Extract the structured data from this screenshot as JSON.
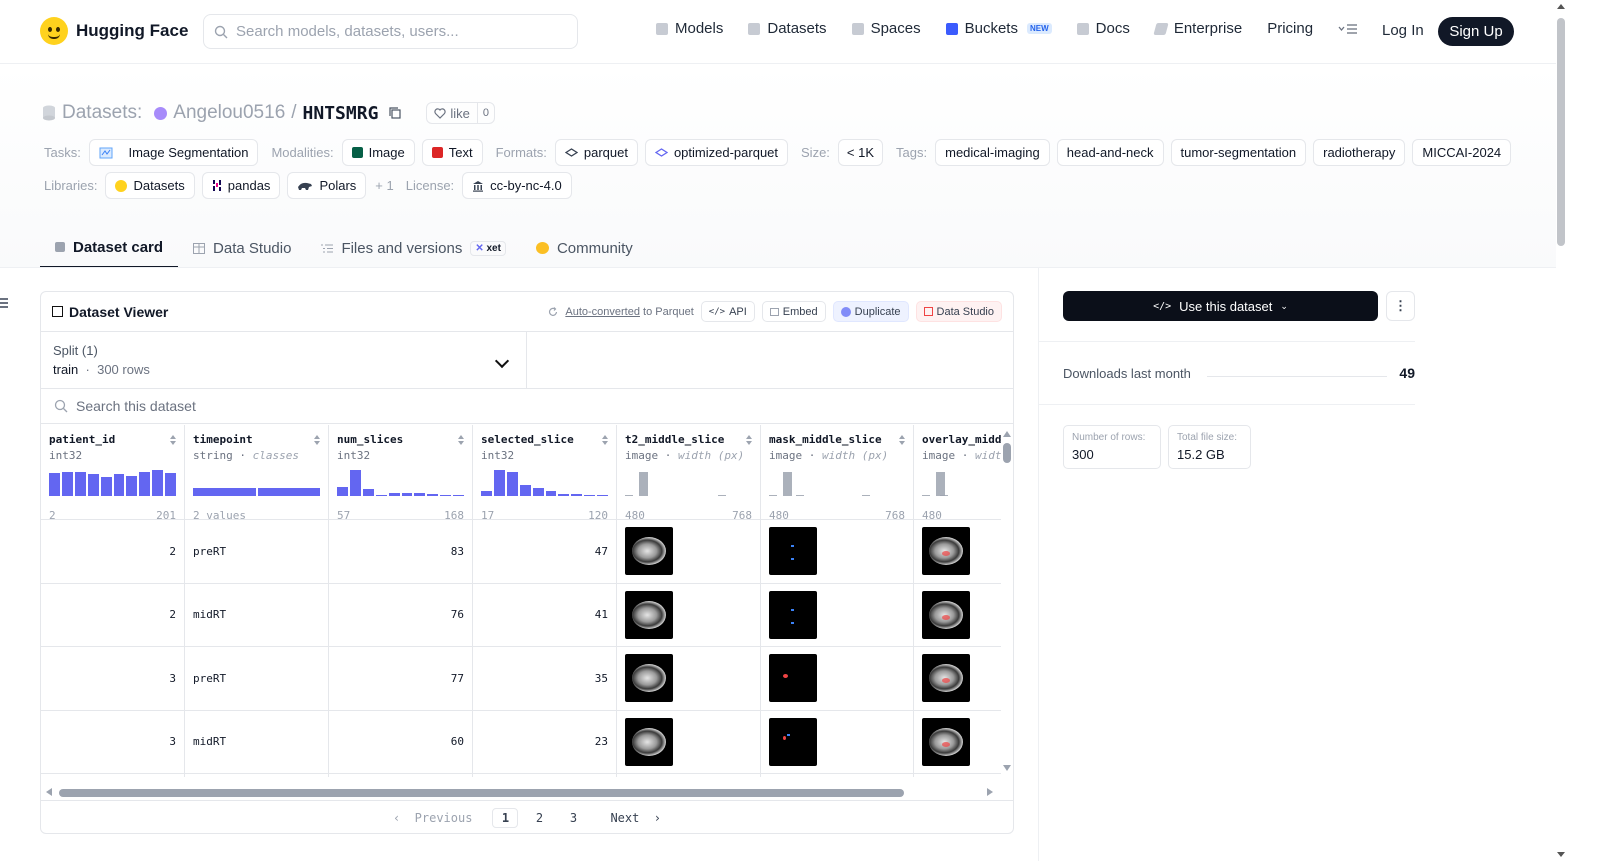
{
  "header": {
    "brand": "Hugging Face",
    "search_placeholder": "Search models, datasets, users...",
    "nav": [
      {
        "label": "Models",
        "icon": "cube-icon"
      },
      {
        "label": "Datasets",
        "icon": "database-icon"
      },
      {
        "label": "Spaces",
        "icon": "grid-icon"
      },
      {
        "label": "Buckets",
        "icon": "bucket-icon",
        "badge": "NEW"
      },
      {
        "label": "Docs",
        "icon": "book-icon"
      },
      {
        "label": "Enterprise",
        "icon": "enterprise-icon"
      },
      {
        "label": "Pricing"
      }
    ],
    "login": "Log In",
    "signup": "Sign Up"
  },
  "repo": {
    "section": "Datasets:",
    "owner": "Angelou0516",
    "separator": "/",
    "name": "HNTSMRG",
    "like_label": "like",
    "like_count": "0"
  },
  "meta": {
    "tasks_label": "Tasks:",
    "tasks": [
      "Image Segmentation"
    ],
    "modalities_label": "Modalities:",
    "modalities": [
      "Image",
      "Text"
    ],
    "formats_label": "Formats:",
    "formats": [
      "parquet",
      "optimized-parquet"
    ],
    "size_label": "Size:",
    "size": "< 1K",
    "tags_label": "Tags:",
    "tags": [
      "medical-imaging",
      "head-and-neck",
      "tumor-segmentation",
      "radiotherapy",
      "MICCAI-2024"
    ],
    "libraries_label": "Libraries:",
    "libraries": [
      "Datasets",
      "pandas",
      "Polars"
    ],
    "libraries_more": "+ 1",
    "license_label": "License:",
    "license": "cc-by-nc-4.0"
  },
  "tabs": [
    {
      "label": "Dataset card",
      "active": true
    },
    {
      "label": "Data Studio"
    },
    {
      "label": "Files and versions",
      "badge": "xet"
    },
    {
      "label": "Community"
    }
  ],
  "viewer": {
    "title": "Dataset Viewer",
    "auto_converted": "Auto-converted",
    "to_parquet": "to Parquet",
    "buttons": [
      "API",
      "Embed",
      "Duplicate",
      "Data Studio"
    ],
    "split_label": "Split (1)",
    "split_name": "train",
    "split_rows": "300 rows",
    "search_placeholder": "Search this dataset",
    "columns": [
      {
        "name": "patient_id",
        "type": "int32",
        "min": "2",
        "max": "201",
        "hist": [
          0.85,
          0.9,
          0.88,
          0.8,
          0.72,
          0.8,
          0.75,
          0.9,
          0.95,
          0.85
        ]
      },
      {
        "name": "timepoint",
        "type": "string",
        "subtype": "classes",
        "min": "2 values",
        "max": "",
        "hist": [
          0.3,
          0.3
        ]
      },
      {
        "name": "num_slices",
        "type": "int32",
        "min": "57",
        "max": "168",
        "hist": [
          0.35,
          0.95,
          0.25,
          0.05,
          0.1,
          0.1,
          0.1,
          0.08,
          0.05,
          0.05
        ]
      },
      {
        "name": "selected_slice",
        "type": "int32",
        "min": "17",
        "max": "120",
        "hist": [
          0.2,
          0.95,
          0.9,
          0.4,
          0.28,
          0.18,
          0.08,
          0.08,
          0.03,
          0.05
        ]
      },
      {
        "name": "t2_middle_slice",
        "type": "image",
        "subtype": "width (px)",
        "min": "480",
        "max": "768",
        "hist": [
          0.04,
          0.9,
          0,
          0,
          0.04,
          0,
          0,
          0.04
        ]
      },
      {
        "name": "mask_middle_slice",
        "type": "image",
        "subtype": "width (px)",
        "min": "480",
        "max": "768",
        "hist": [
          0.04,
          0.9,
          0,
          0,
          0.04,
          0,
          0,
          0.04
        ]
      },
      {
        "name": "overlay_middle_slice",
        "type": "image",
        "subtype": "width (px)",
        "min": "480",
        "max": "",
        "hist": [
          0.04,
          0.9,
          0,
          0,
          0.04
        ]
      }
    ],
    "rows": [
      {
        "patient_id": "2",
        "timepoint": "preRT",
        "num_slices": "83",
        "selected_slice": "47"
      },
      {
        "patient_id": "2",
        "timepoint": "midRT",
        "num_slices": "76",
        "selected_slice": "41"
      },
      {
        "patient_id": "3",
        "timepoint": "preRT",
        "num_slices": "77",
        "selected_slice": "35"
      },
      {
        "patient_id": "3",
        "timepoint": "midRT",
        "num_slices": "60",
        "selected_slice": "23"
      }
    ],
    "pager": {
      "previous": "Previous",
      "pages": [
        "1",
        "2",
        "3"
      ],
      "current": "1",
      "next": "Next"
    }
  },
  "side": {
    "use_button": "Use this dataset",
    "downloads_label": "Downloads last month",
    "downloads_value": "49",
    "rows_label": "Number of rows:",
    "rows_value": "300",
    "size_label": "Total file size:",
    "size_value": "15.2 GB"
  }
}
